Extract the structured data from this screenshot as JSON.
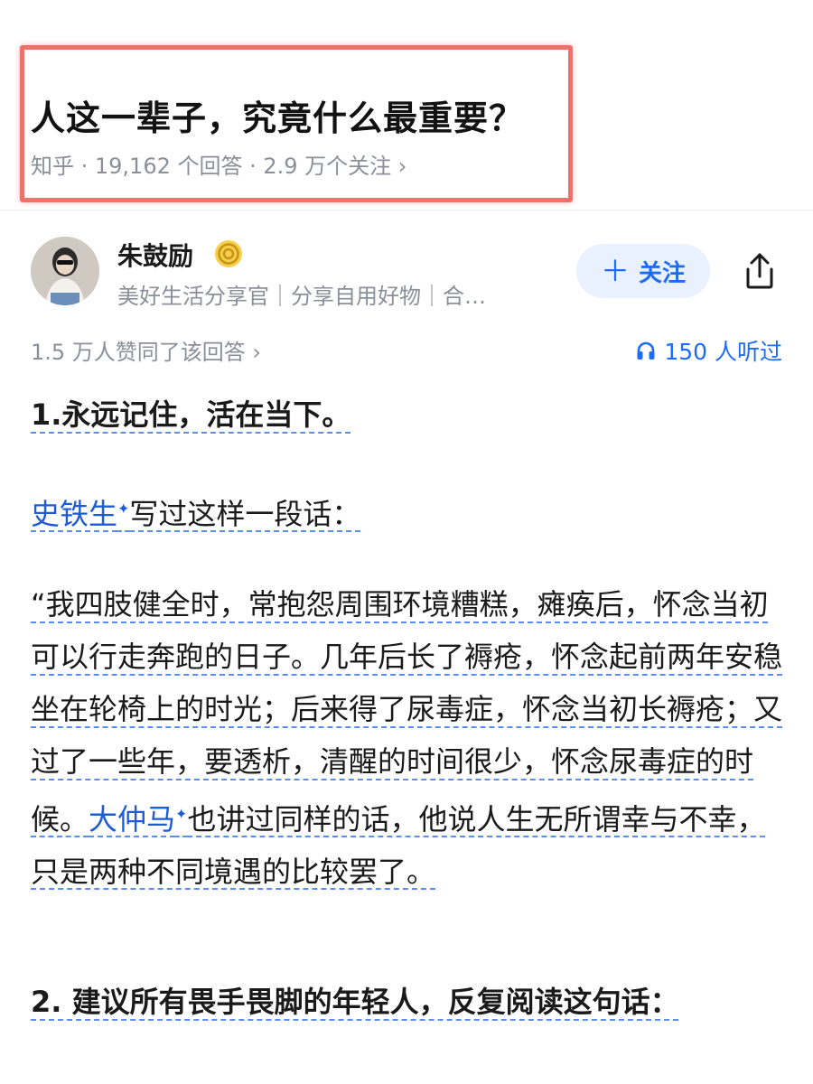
{
  "question": {
    "title": "人这一辈子，究竟什么最重要？",
    "meta": "知乎 · 19,162 个回答 · 2.9 万个关注 ›"
  },
  "author": {
    "name": "朱鼓励",
    "bio": "美好生活分享官｜分享自用好物｜合…",
    "follow_label": "关注",
    "badge_icon": "gold-badge-icon",
    "share_icon": "share-icon"
  },
  "stats": {
    "votes": "1.5 万人赞同了该回答 ›",
    "listeners": "150 人听过"
  },
  "answer": {
    "p1": "1.永远记住，活在当下。",
    "p2_link": "史铁生",
    "p2_rest": "写过这样一段话：",
    "p3_a": "“我四肢健全时，常抱怨周围环境糟糕，瘫痪后，怀念当初可以行走奔跑的日子。几年后长了褥疮，怀念起前两年安稳坐在轮椅上的时光；后来得了尿毒症，怀念当初长褥疮；又过了一些年，要透析，清醒的时间很少，怀念尿毒症的时候。",
    "p3_link": "大仲马",
    "p3_b": "也讲过同样的话，他说人生无所谓幸与不幸，只是两种不同境遇的比较罢了。",
    "p4": "2. 建议所有畏手畏脚的年轻人，反复阅读这句话："
  },
  "colors": {
    "accent": "#1e6cf5",
    "highlight_box": "#f0706a",
    "muted": "#8a8f99"
  }
}
